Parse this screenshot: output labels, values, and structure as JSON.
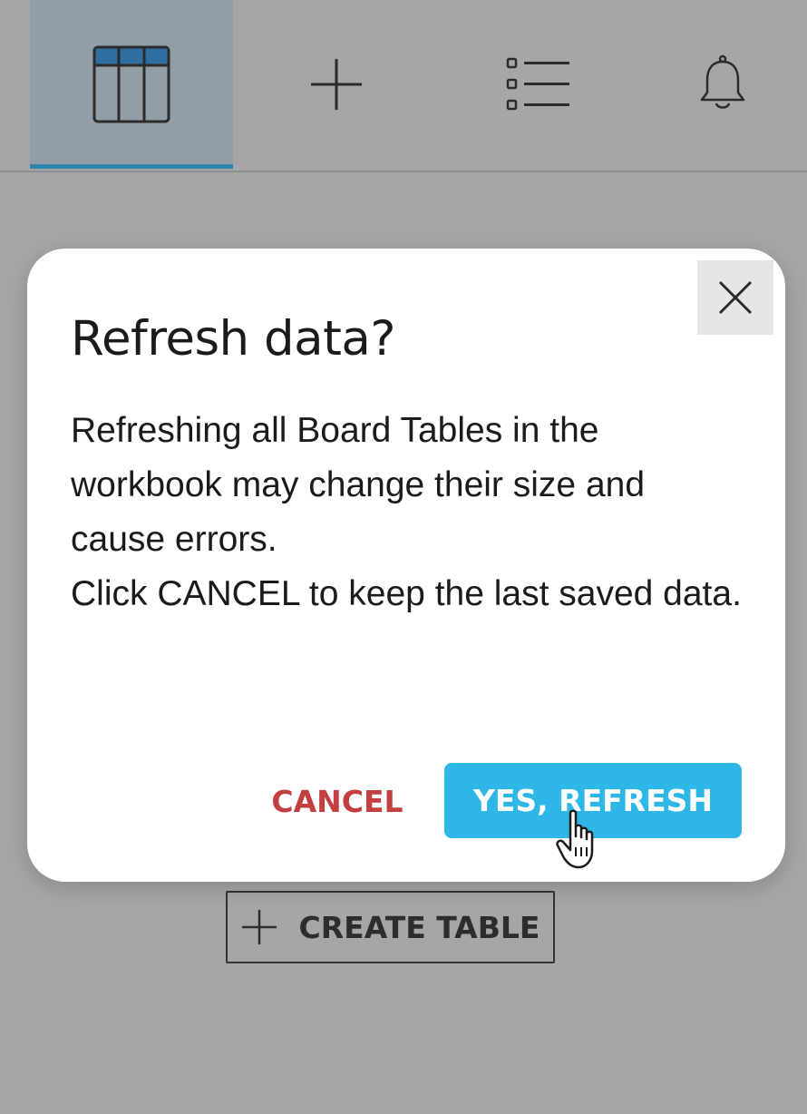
{
  "toolbar": {
    "tools": [
      {
        "icon": "table-icon",
        "active": true
      },
      {
        "icon": "plus-icon",
        "active": false
      },
      {
        "icon": "list-icon",
        "active": false
      },
      {
        "icon": "bell-icon",
        "active": false
      }
    ]
  },
  "background": {
    "create_table_label": "CREATE TABLE"
  },
  "dialog": {
    "title": "Refresh data?",
    "body_line1": "Refreshing all Board Tables in the workbook may change their size and cause errors.",
    "body_line2": "Click CANCEL to keep the last saved data.",
    "cancel_label": "CANCEL",
    "confirm_label": "YES, REFRESH"
  },
  "colors": {
    "accent": "#2eb7e6",
    "cancel": "#c43f3f",
    "active_tab_underline": "#2c86ab"
  }
}
